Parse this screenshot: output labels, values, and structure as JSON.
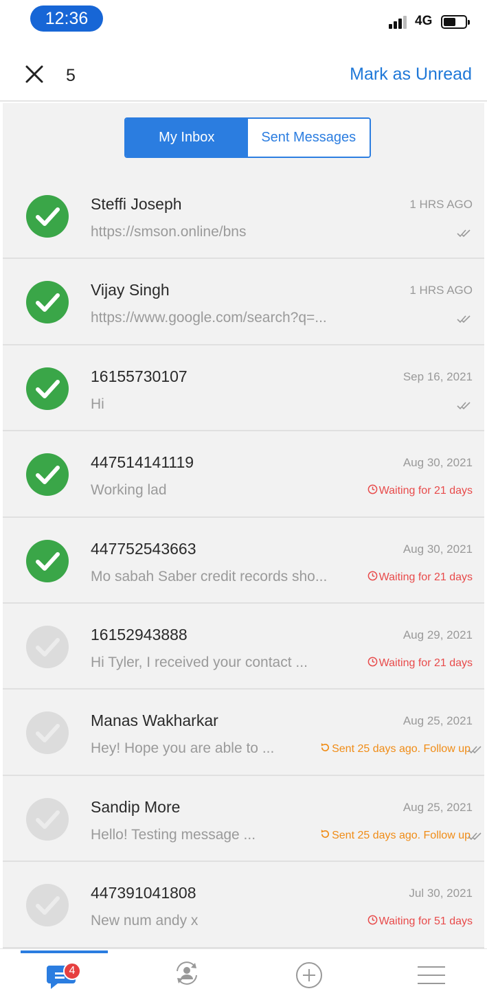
{
  "status_bar": {
    "time": "12:36",
    "network": "4G"
  },
  "header": {
    "selected_count": "5",
    "mark_unread_label": "Mark as Unread"
  },
  "segment": {
    "inbox_label": "My Inbox",
    "sent_label": "Sent Messages"
  },
  "colors": {
    "accent": "#2b7de0",
    "check_green": "#3aa648",
    "waiting_red": "#e84a4a",
    "followup_orange": "#f08c16"
  },
  "messages": [
    {
      "name": "Steffi Joseph",
      "date": "1 HRS AGO",
      "preview": "https://smson.online/bns",
      "checked": true,
      "status": ""
    },
    {
      "name": "Vijay Singh",
      "date": "1 HRS AGO",
      "preview": "https://www.google.com/search?q=...",
      "checked": true,
      "status": ""
    },
    {
      "name": "16155730107",
      "date": "Sep 16, 2021",
      "preview": "Hi",
      "checked": true,
      "status": ""
    },
    {
      "name": "447514141119",
      "date": "Aug 30, 2021",
      "preview": "Working lad",
      "checked": true,
      "status": "Waiting for 21 days"
    },
    {
      "name": "447752543663",
      "date": "Aug 30, 2021",
      "preview": "Mo sabah Saber credit records sho...",
      "checked": true,
      "status": "Waiting for 21 days"
    },
    {
      "name": "16152943888",
      "date": "Aug 29, 2021",
      "preview": "Hi Tyler, I received your contact ...",
      "checked": false,
      "status": "Waiting for 21 days"
    },
    {
      "name": "Manas Wakharkar",
      "date": "Aug 25, 2021",
      "preview": "Hey! Hope you are able to ...",
      "checked": false,
      "status": "Sent 25 days ago. Follow up"
    },
    {
      "name": "Sandip More",
      "date": "Aug 25, 2021",
      "preview": "Hello! Testing message ...",
      "checked": false,
      "status": "Sent 25 days ago. Follow up"
    },
    {
      "name": "447391041808",
      "date": "Jul 30, 2021",
      "preview": "New num andy x",
      "checked": false,
      "status": "Waiting for 51 days"
    }
  ],
  "tabbar": {
    "unread_badge": "4",
    "icons": [
      "messages-icon",
      "contacts-sync-icon",
      "add-icon",
      "menu-icon"
    ]
  }
}
